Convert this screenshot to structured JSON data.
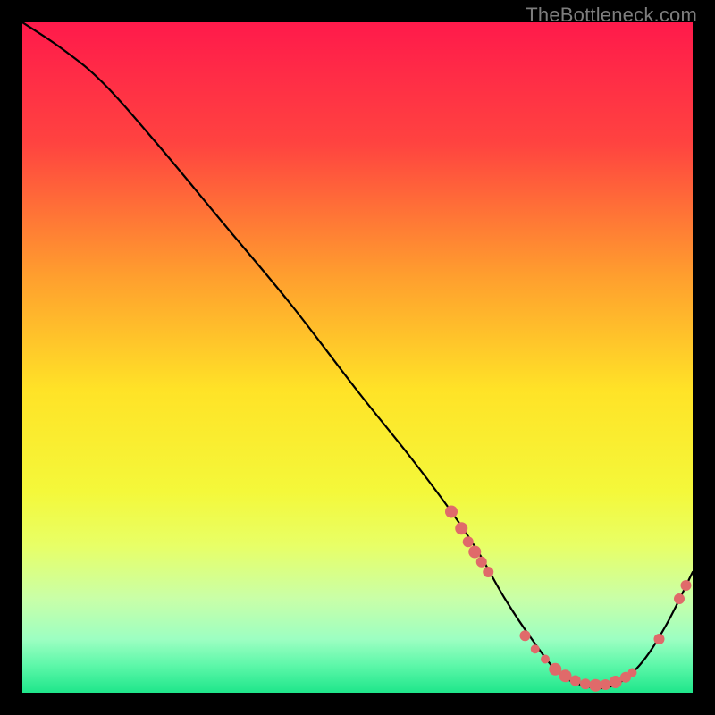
{
  "watermark": "TheBottleneck.com",
  "chart_data": {
    "type": "line",
    "title": "",
    "xlabel": "",
    "ylabel": "",
    "xlim": [
      0,
      100
    ],
    "ylim": [
      0,
      100
    ],
    "gradient_stops": [
      {
        "pct": 0,
        "color": "#ff1a4b"
      },
      {
        "pct": 18,
        "color": "#ff4340"
      },
      {
        "pct": 38,
        "color": "#ff9f2e"
      },
      {
        "pct": 55,
        "color": "#ffe327"
      },
      {
        "pct": 70,
        "color": "#f4f83a"
      },
      {
        "pct": 78,
        "color": "#e8ff66"
      },
      {
        "pct": 86,
        "color": "#c9ffa8"
      },
      {
        "pct": 92,
        "color": "#9dffc2"
      },
      {
        "pct": 96,
        "color": "#5cf7a9"
      },
      {
        "pct": 100,
        "color": "#1fe68b"
      }
    ],
    "series": [
      {
        "name": "bottleneck-curve",
        "color": "#000000",
        "x": [
          0,
          6,
          12,
          20,
          30,
          40,
          50,
          58,
          64,
          68,
          72,
          76,
          80,
          84,
          88,
          92,
          96,
          100
        ],
        "y": [
          100,
          96,
          91,
          82,
          70,
          58,
          45,
          35,
          27,
          21,
          14,
          8,
          3,
          1,
          1,
          4,
          10,
          18
        ]
      }
    ],
    "markers": {
      "color": "#e06a6a",
      "radius_small": 5,
      "radius_large": 7,
      "points": [
        {
          "x": 64.0,
          "y": 27.0,
          "r": 7
        },
        {
          "x": 65.5,
          "y": 24.5,
          "r": 7
        },
        {
          "x": 66.5,
          "y": 22.5,
          "r": 6
        },
        {
          "x": 67.5,
          "y": 21.0,
          "r": 7
        },
        {
          "x": 68.5,
          "y": 19.5,
          "r": 6
        },
        {
          "x": 69.5,
          "y": 18.0,
          "r": 6
        },
        {
          "x": 75.0,
          "y": 8.5,
          "r": 6
        },
        {
          "x": 76.5,
          "y": 6.5,
          "r": 5
        },
        {
          "x": 78.0,
          "y": 5.0,
          "r": 5
        },
        {
          "x": 79.5,
          "y": 3.5,
          "r": 7
        },
        {
          "x": 81.0,
          "y": 2.5,
          "r": 7
        },
        {
          "x": 82.5,
          "y": 1.8,
          "r": 6
        },
        {
          "x": 84.0,
          "y": 1.3,
          "r": 6
        },
        {
          "x": 85.5,
          "y": 1.1,
          "r": 7
        },
        {
          "x": 87.0,
          "y": 1.2,
          "r": 6
        },
        {
          "x": 88.5,
          "y": 1.6,
          "r": 7
        },
        {
          "x": 90.0,
          "y": 2.3,
          "r": 6
        },
        {
          "x": 91.0,
          "y": 3.0,
          "r": 5
        },
        {
          "x": 95.0,
          "y": 8.0,
          "r": 6
        },
        {
          "x": 98.0,
          "y": 14.0,
          "r": 6
        },
        {
          "x": 99.0,
          "y": 16.0,
          "r": 6
        }
      ]
    }
  }
}
